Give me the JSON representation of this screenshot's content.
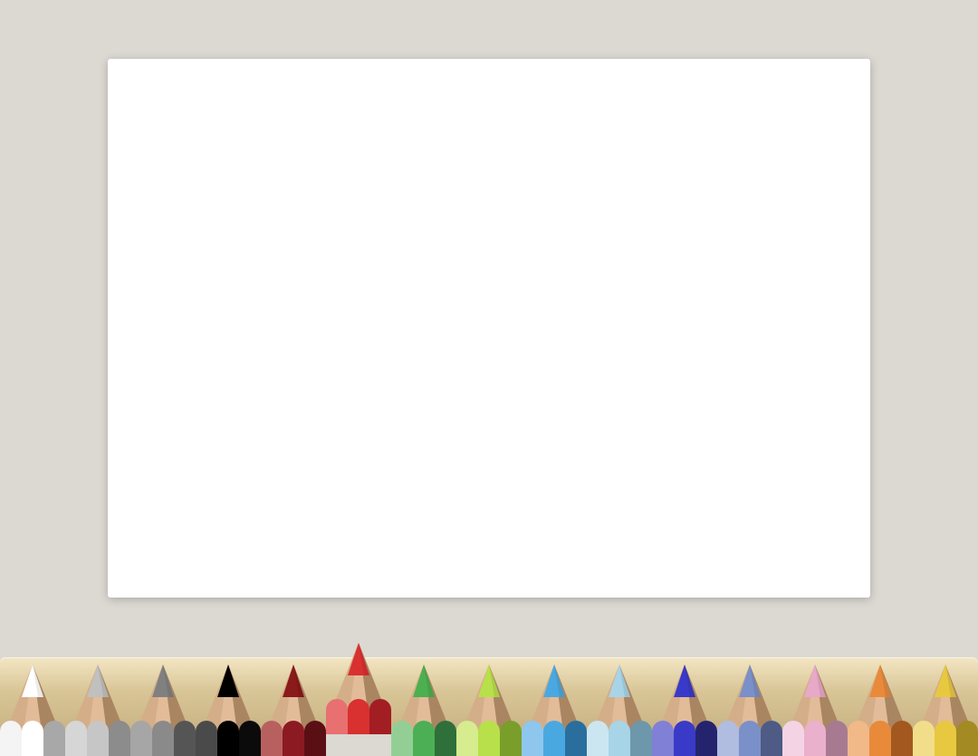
{
  "canvas": {
    "background": "#ffffff"
  },
  "palette": {
    "selected_index": 5,
    "pencils": [
      {
        "name": "white",
        "tip": "#ffffff",
        "light": "#f4f4f4",
        "mid": "#ffffff",
        "dark": "#a8a8a8"
      },
      {
        "name": "light-gray",
        "tip": "#c0c0c0",
        "light": "#d6d6d6",
        "mid": "#c6c6c6",
        "dark": "#8c8c8c"
      },
      {
        "name": "gray",
        "tip": "#808080",
        "light": "#a6a6a6",
        "mid": "#8a8a8a",
        "dark": "#555555"
      },
      {
        "name": "black",
        "tip": "#000000",
        "light": "#4a4a4a",
        "mid": "#000000",
        "dark": "#0b0b0b"
      },
      {
        "name": "dark-red",
        "tip": "#8b1a1a",
        "light": "#b86060",
        "mid": "#8b1a22",
        "dark": "#5a0f14"
      },
      {
        "name": "red",
        "tip": "#d93030",
        "light": "#e87070",
        "mid": "#d93030",
        "dark": "#a21e22"
      },
      {
        "name": "green",
        "tip": "#4caf50",
        "light": "#93cf95",
        "mid": "#4caf55",
        "dark": "#2f6f3a"
      },
      {
        "name": "lime",
        "tip": "#b8e04a",
        "light": "#d6ec8e",
        "mid": "#b8e04a",
        "dark": "#7a9e2a"
      },
      {
        "name": "sky-blue",
        "tip": "#4aa8e0",
        "light": "#8ec6ee",
        "mid": "#4aa8e0",
        "dark": "#2a6e9e"
      },
      {
        "name": "light-blue",
        "tip": "#a8d4e8",
        "light": "#cce6f1",
        "mid": "#a8d4e8",
        "dark": "#6d97ab"
      },
      {
        "name": "blue",
        "tip": "#3a3ac8",
        "light": "#8080d6",
        "mid": "#3a3ac8",
        "dark": "#24246e"
      },
      {
        "name": "periwinkle",
        "tip": "#7a90c8",
        "light": "#b0bce0",
        "mid": "#7a90c8",
        "dark": "#4d5b85"
      },
      {
        "name": "pink",
        "tip": "#e8a8c8",
        "light": "#f4d4e4",
        "mid": "#ebb0cc",
        "dark": "#a87a91"
      },
      {
        "name": "orange",
        "tip": "#e88a3a",
        "light": "#f1b888",
        "mid": "#e88a3a",
        "dark": "#a2581e"
      },
      {
        "name": "yellow",
        "tip": "#e8c840",
        "light": "#f2de8a",
        "mid": "#e8c840",
        "dark": "#a48a22"
      }
    ]
  }
}
